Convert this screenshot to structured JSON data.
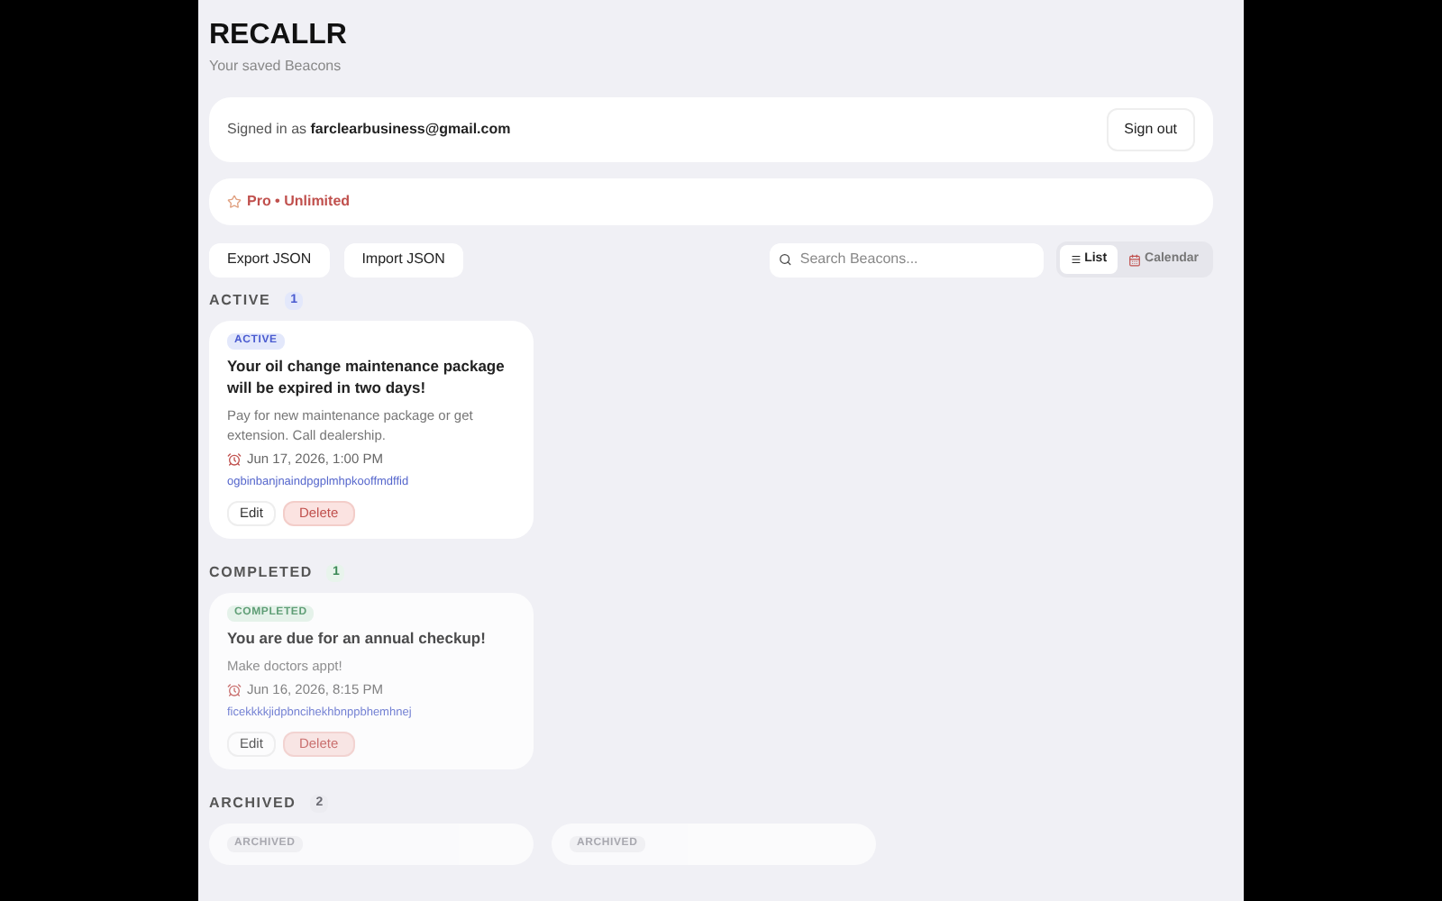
{
  "header": {
    "title": "RECALLR",
    "subtitle": "Your saved Beacons"
  },
  "account": {
    "prefix": "Signed in as",
    "email": "farclearbusiness@gmail.com",
    "button": "Sign out"
  },
  "plan": {
    "label": "Pro • Unlimited"
  },
  "toolbar": {
    "buttons": [
      "Export JSON",
      "Import JSON"
    ],
    "search": {
      "placeholder": "Search Beacons..."
    },
    "views": [
      {
        "label": "List",
        "kind": "list",
        "selected": true
      },
      {
        "label": "Calendar",
        "kind": "calendar",
        "selected": false
      }
    ]
  },
  "sections": [
    {
      "kind": "active",
      "title": "ACTIVE",
      "count": "1",
      "cards": [
        {
          "badge": "ACTIVE",
          "title": "Your oil change maintenance package will be expired in two days!",
          "body": "Pay for new maintenance package or get extension. Call dealership.",
          "due": "Jun 17, 2026, 1:00 PM",
          "id": "ogbinbanjnaindpgplmhpkooffmdffid",
          "actions": [
            "Edit",
            "Delete"
          ]
        }
      ]
    },
    {
      "kind": "completed",
      "title": "COMPLETED",
      "count": "1",
      "cards": [
        {
          "badge": "COMPLETED",
          "title": "You are due for an annual checkup!",
          "body": "Make doctors appt!",
          "due": "Jun 16, 2026, 8:15 PM",
          "id": "ficekkkkjidpbncihekhbnppbhemhnej",
          "actions": [
            "Edit",
            "Delete"
          ]
        }
      ]
    },
    {
      "kind": "archived",
      "title": "ARCHIVED",
      "count": "2",
      "cards": [
        {
          "badge": "ARCHIVED"
        },
        {
          "badge": "ARCHIVED"
        }
      ]
    }
  ]
}
